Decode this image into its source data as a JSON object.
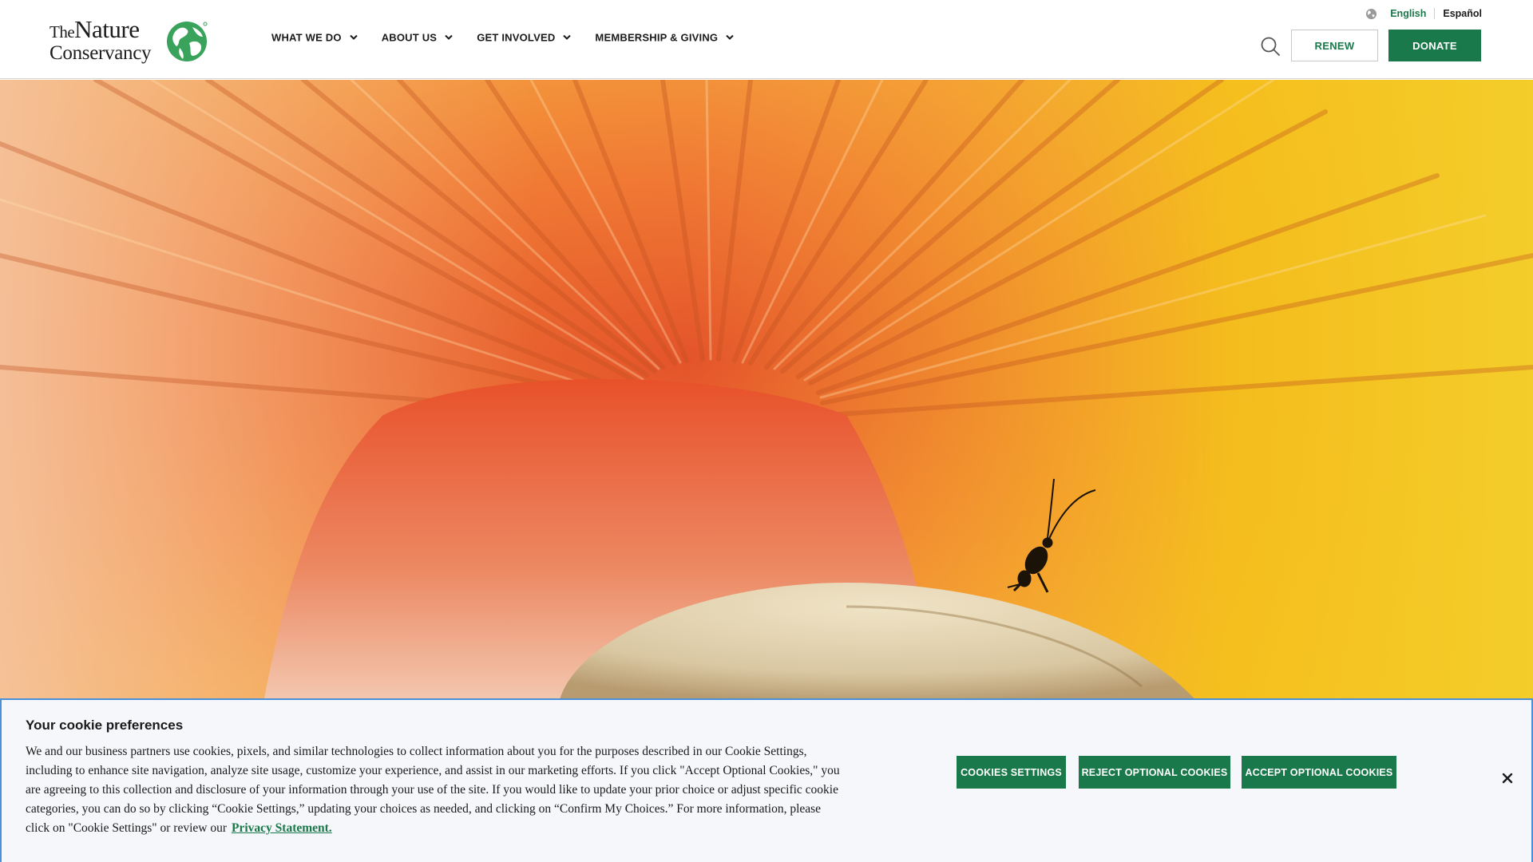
{
  "brand": {
    "logo_line1_small": "The",
    "logo_line1_large": "Nature",
    "logo_line2": "Conservancy",
    "green": "#19794a"
  },
  "nav": {
    "items": [
      {
        "label": "WHAT WE DO",
        "icon": "chevron-down-icon"
      },
      {
        "label": "ABOUT US",
        "icon": "chevron-down-icon"
      },
      {
        "label": "GET INVOLVED",
        "icon": "chevron-down-icon"
      },
      {
        "label": "MEMBERSHIP & GIVING",
        "icon": "chevron-down-icon"
      }
    ]
  },
  "language": {
    "icon": "globe-icon",
    "english": "English",
    "spanish": "Español"
  },
  "header_actions": {
    "search_icon": "search-icon",
    "renew_label": "RENEW",
    "donate_label": "DONATE"
  },
  "hero": {
    "subject": "mushroom-gills-with-insect",
    "colors": [
      "#e8602c",
      "#f59a3a",
      "#f2c01a",
      "#f5d9c3"
    ]
  },
  "cookie_banner": {
    "title": "Your cookie preferences",
    "body": "We and our business partners use cookies, pixels, and similar technologies to collect information about you for the purposes described in our Cookie Settings, including to enhance site navigation, analyze site usage, customize your experience, and assist in our marketing efforts. If you click \"Accept Optional Cookies,\" you are agreeing to this collection and disclosure of your information through your use of the site. If you would like to update your prior choice or adjust specific cookie categories, you can do so by clicking “Cookie Settings,” updating your choices as needed, and clicking on “Confirm My Choices.” For more information, please click on \"Cookie Settings\" or review our",
    "link_label": "Privacy Statement.",
    "settings_label": "COOKIES SETTINGS",
    "reject_label": "REJECT OPTIONAL COOKIES",
    "accept_label": "ACCEPT OPTIONAL COOKIES",
    "close_icon": "close-icon",
    "border_color": "#4a90d9"
  }
}
